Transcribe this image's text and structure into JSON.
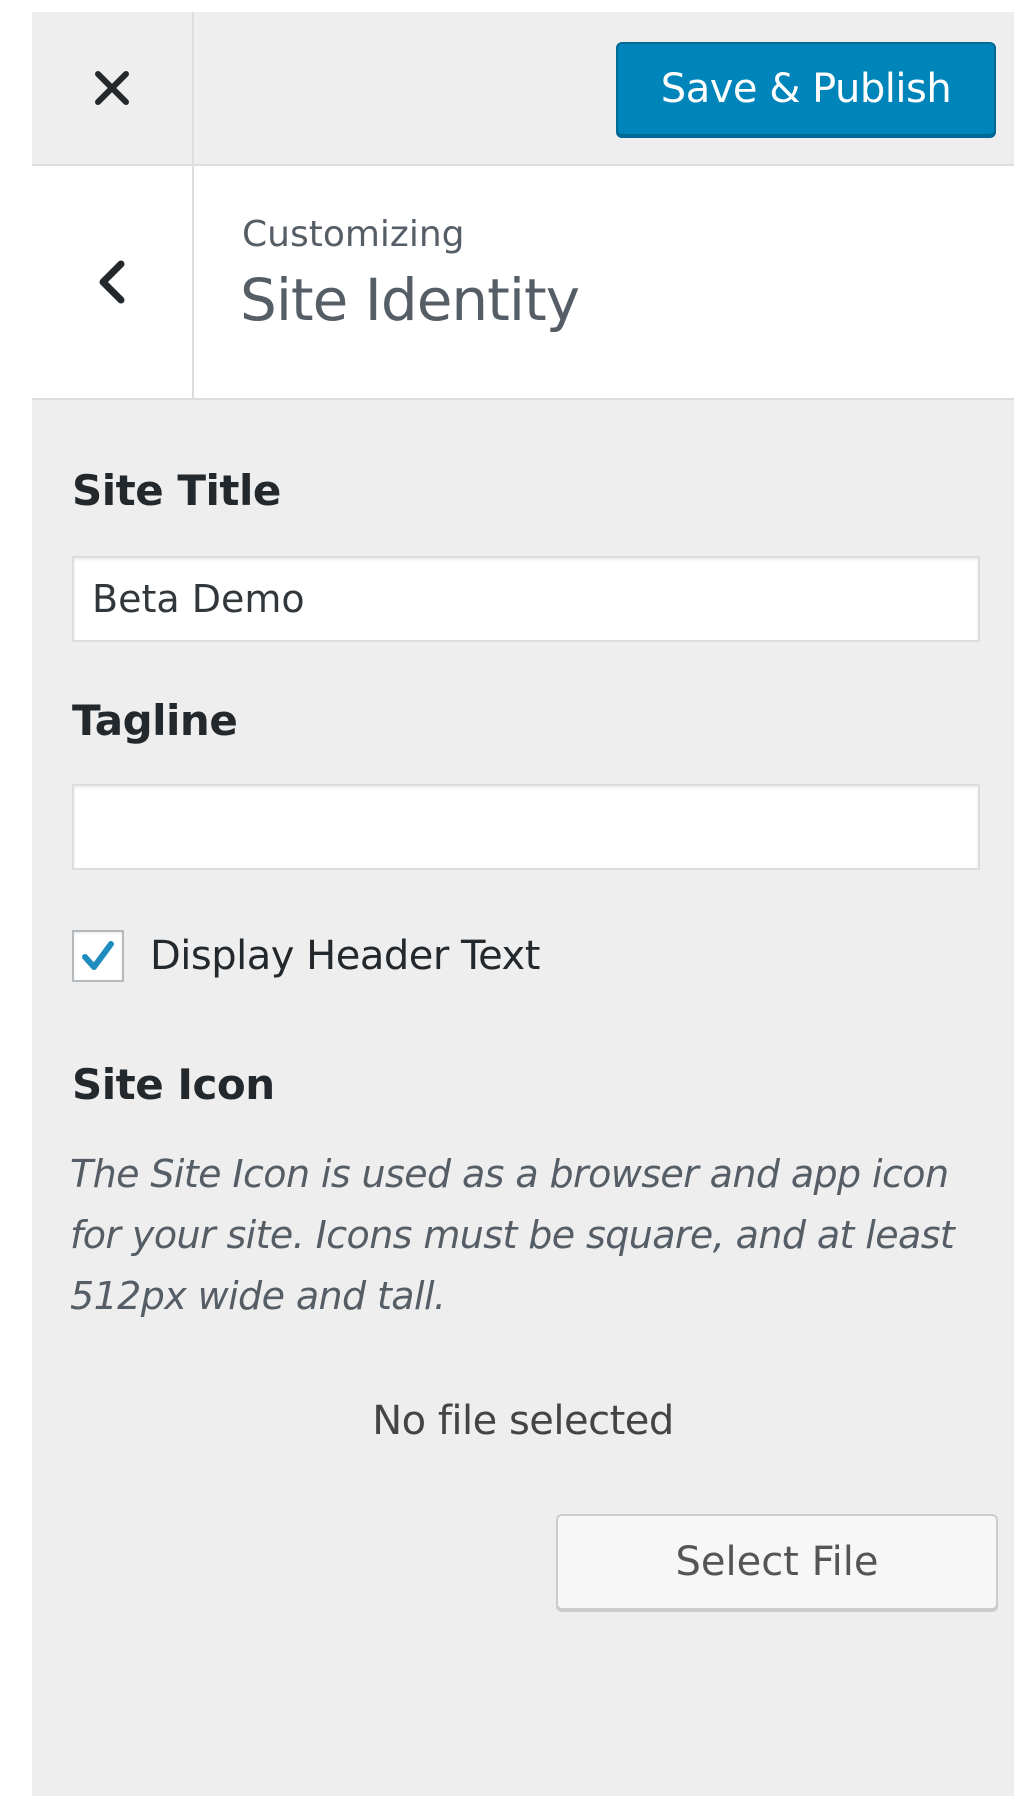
{
  "header": {
    "close_icon": "close-icon",
    "save_label": "Save & Publish",
    "accent_color": "#0085ba"
  },
  "section": {
    "back_icon": "chevron-left-icon",
    "eyebrow": "Customizing",
    "title": "Site Identity"
  },
  "fields": {
    "site_title": {
      "label": "Site Title",
      "value": "Beta Demo"
    },
    "tagline": {
      "label": "Tagline",
      "value": ""
    },
    "display_header_text": {
      "label": "Display Header Text",
      "checked": true
    }
  },
  "site_icon": {
    "label": "Site Icon",
    "description": "The Site Icon is used as a browser and app icon for your site. Icons must be square, and at least 512px wide and tall.",
    "status": "No file selected",
    "select_label": "Select File"
  }
}
